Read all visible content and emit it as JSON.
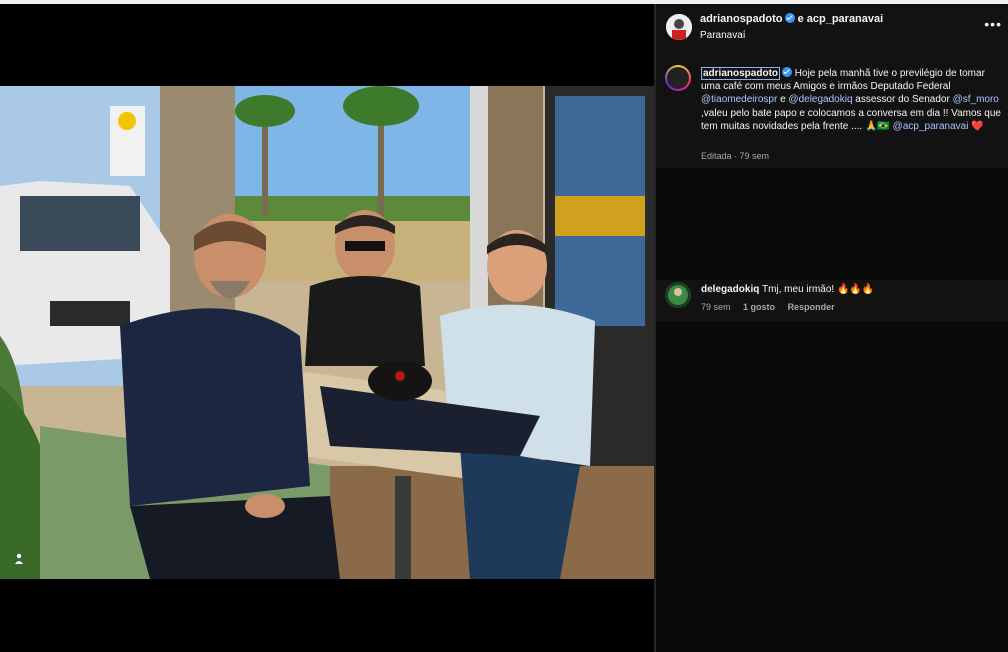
{
  "header": {
    "usernames": "adrianospadoto",
    "and_text": "e acp_paranavai",
    "location": "Paranavaí",
    "more_icon": "more-horizontal-icon"
  },
  "caption": {
    "username": "adrianospadoto",
    "text_1": "Hoje pela manhã tive o previlégio de tomar uma café com meus Amigos e irmãos Deputado Federal",
    "mention_1": "@tiaomedeirospr",
    "text_2": " e ",
    "mention_2": "@delegadokiq",
    "text_3": " assessor do Senador",
    "mention_3": "@sf_moro",
    "text_4": " ,valeu pelo bate papo e colocamos a conversa em dia !! Vamos que tem muitas novidades pela frente .... 🙏🇧🇷",
    "mention_4": "@acp_paranavai",
    "text_5": " ❤️",
    "meta": "Editada · 79 sem"
  },
  "comment": {
    "username": "delegadokiq",
    "text": "Tmj, meu irmão! 🔥🔥🔥",
    "time": "79 sem",
    "likes": "1 gosto",
    "reply": "Responder"
  },
  "colors": {
    "panel_bg": "#121212",
    "verified": "#3897f0",
    "mention": "#a9c7ff"
  }
}
